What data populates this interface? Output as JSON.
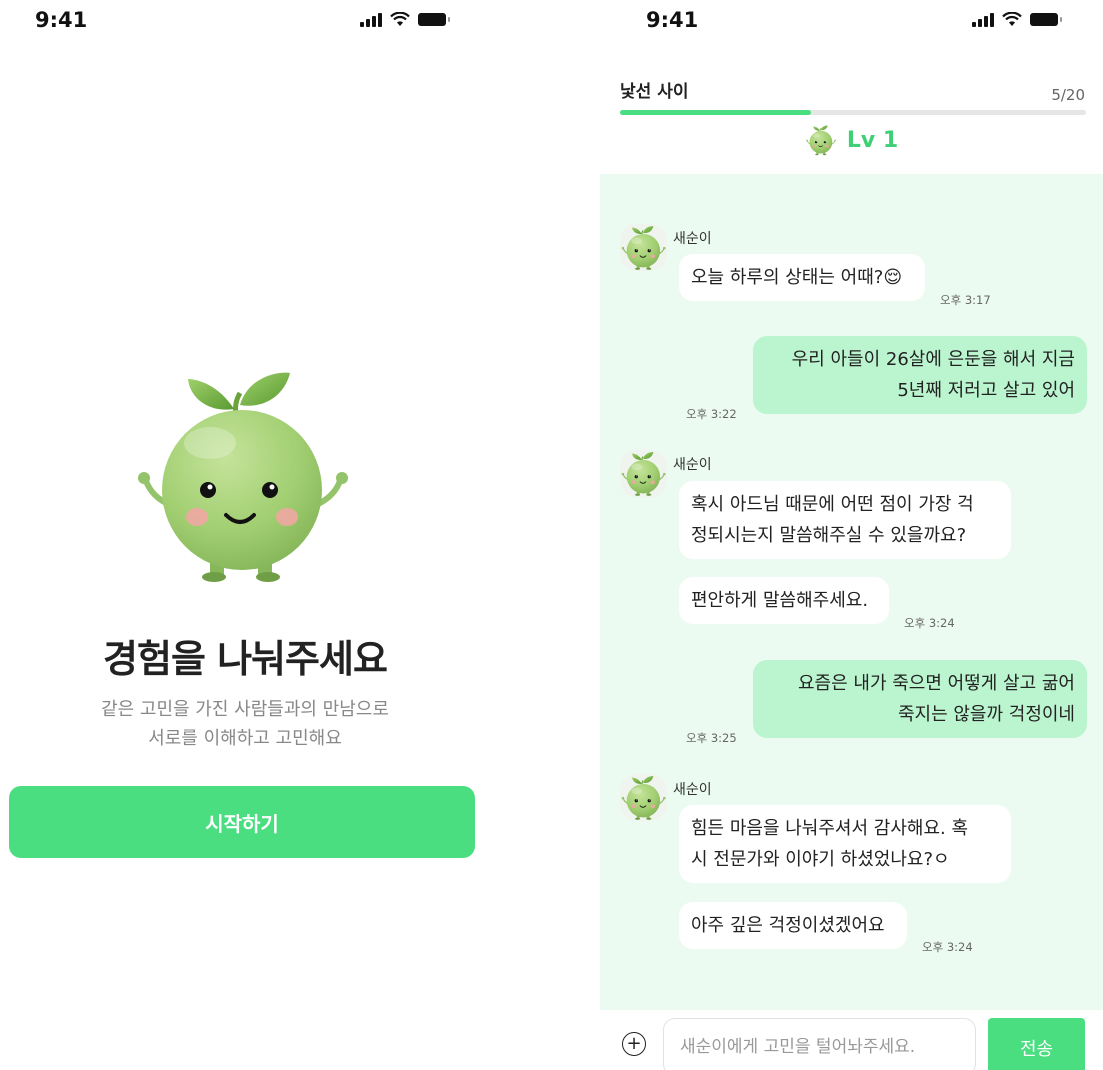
{
  "colors": {
    "accent": "#4ade80",
    "chat_bg": "#ecfbf1",
    "bubble_out": "#bbf5cf"
  },
  "onboarding": {
    "status_time": "9:41",
    "headline": "경험을 나눠주세요",
    "subtext_line1": "같은 고민을 가진 사람들과의 만남으로",
    "subtext_line2": "서로를 이해하고 고민해요",
    "start_label": "시작하기"
  },
  "chat": {
    "status_time": "9:41",
    "stage_title": "낯선 사이",
    "progress_text": "5/20",
    "progress": {
      "current": 5,
      "total": 20
    },
    "level_label": "Lv 1",
    "messages": [
      {
        "sender": "새순이",
        "lines": [
          "오늘 하루의 상태는 어때?😌"
        ],
        "time": "오후 3:17"
      },
      {
        "lines": [
          "우리 아들이 26살에 은둔을 해서 지금",
          "5년째 저러고 살고 있어"
        ],
        "time": "오후 3:22"
      },
      {
        "sender": "새순이",
        "lines": [
          "혹시 아드님 때문에 어떤 점이 가장 걱",
          "정되시는지 말씀해주실 수 있을까요?"
        ]
      },
      {
        "lines": [
          "편안하게 말씀해주세요."
        ],
        "time": "오후 3:24"
      },
      {
        "lines": [
          "요즘은 내가 죽으면 어떻게 살고 굶어",
          "죽지는 않을까 걱정이네"
        ],
        "time": "오후 3:25"
      },
      {
        "sender": "새순이",
        "lines": [
          "힘든 마음을 나눠주셔서 감사해요. 혹",
          "시 전문가와 이야기 하셨었나요?ㅇ"
        ]
      },
      {
        "lines": [
          "아주 깊은 걱정이셨겠어요"
        ],
        "time": "오후 3:24"
      }
    ],
    "input_placeholder": "새순이에게 고민을 털어놔주세요.",
    "send_label": "전송"
  }
}
